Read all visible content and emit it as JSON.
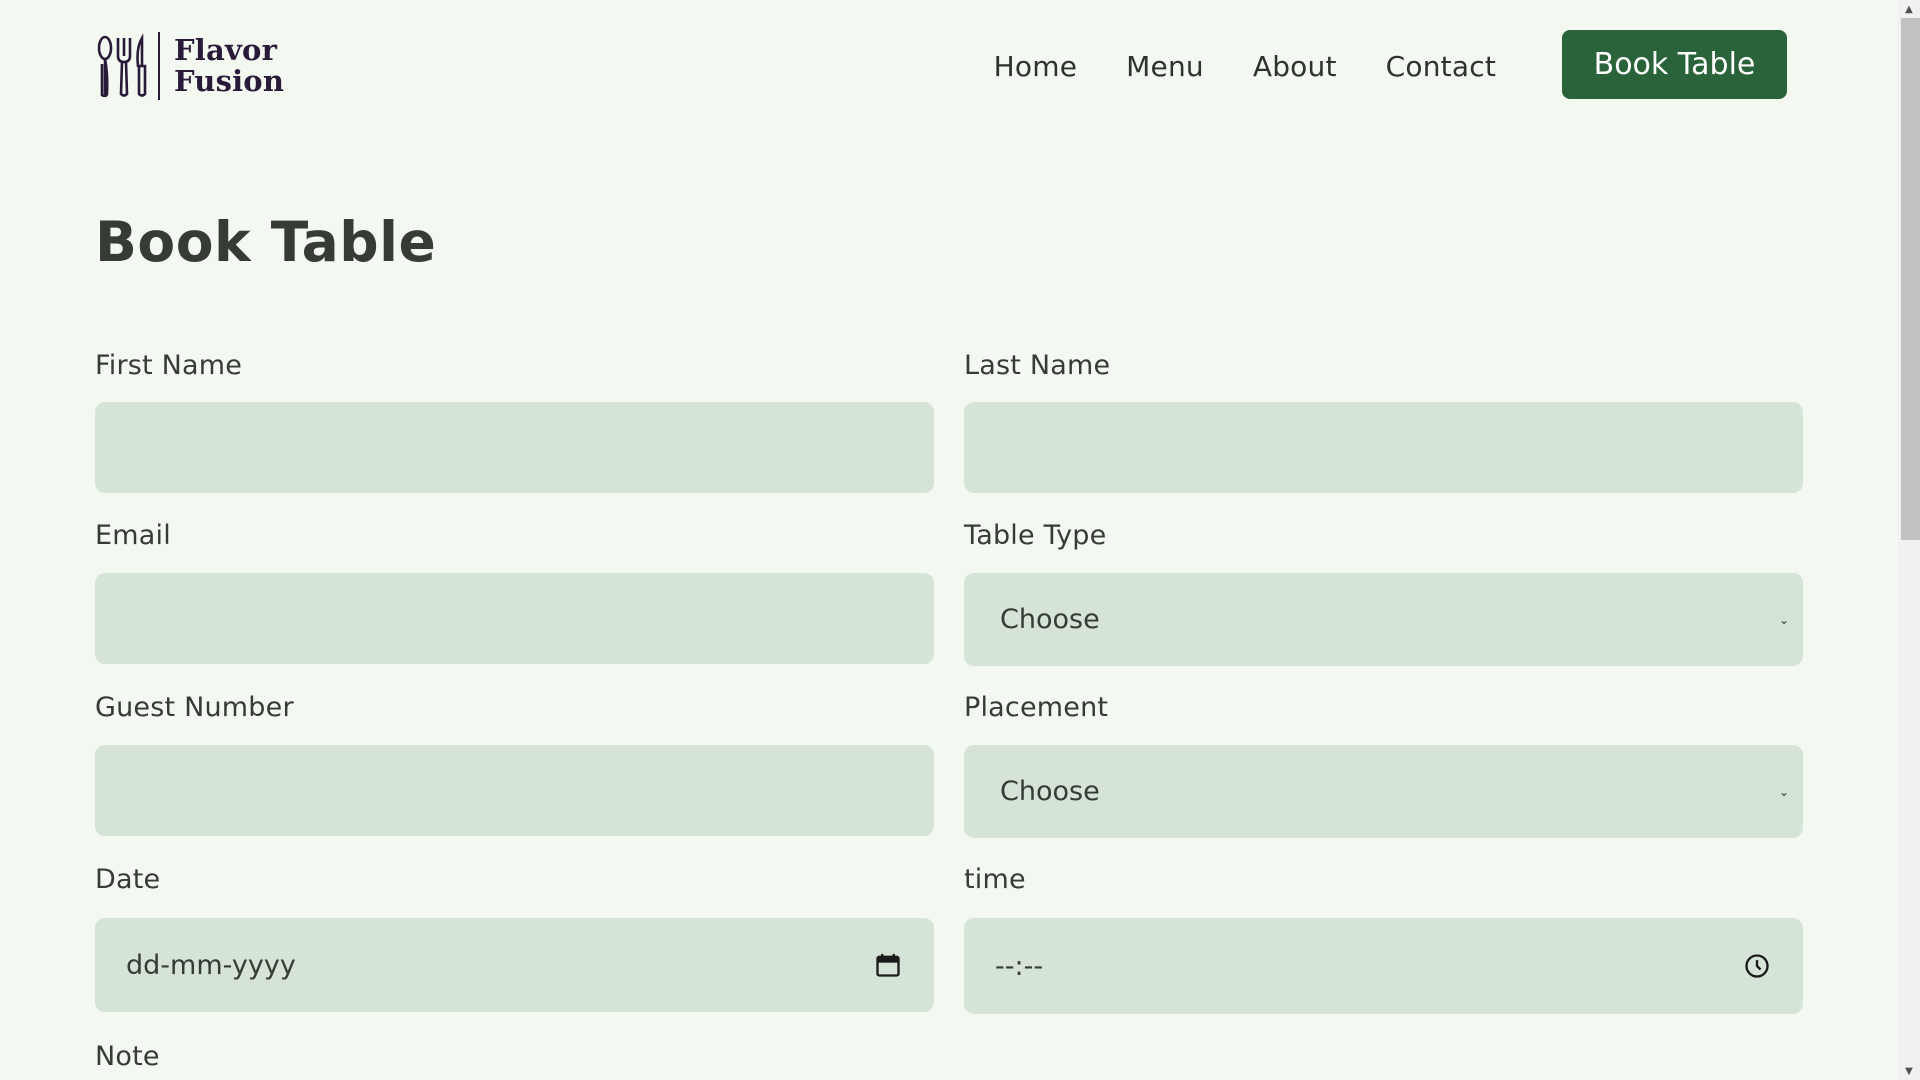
{
  "brand": {
    "line1": "Flavor",
    "line2": "Fusion",
    "logo_icon": "utensils-icon"
  },
  "nav": {
    "items": [
      "Home",
      "Menu",
      "About",
      "Contact"
    ],
    "cta_label": "Book Table"
  },
  "page": {
    "title": "Book Table"
  },
  "form": {
    "first_name": {
      "label": "First Name",
      "value": ""
    },
    "last_name": {
      "label": "Last Name",
      "value": ""
    },
    "email": {
      "label": "Email",
      "value": ""
    },
    "table_type": {
      "label": "Table Type",
      "selected": "Choose"
    },
    "guest_number": {
      "label": "Guest Number",
      "value": ""
    },
    "placement": {
      "label": "Placement",
      "selected": "Choose"
    },
    "date": {
      "label": "Date",
      "placeholder": "dd-mm-yyyy",
      "icon": "calendar-icon"
    },
    "time": {
      "label": "time",
      "placeholder": "--:--",
      "icon": "clock-icon"
    },
    "note": {
      "label": "Note"
    }
  },
  "colors": {
    "background": "#f3f9f1",
    "accent": "#2a6339",
    "field": "#d6e4d7",
    "brand_text": "#2a1a3a"
  }
}
